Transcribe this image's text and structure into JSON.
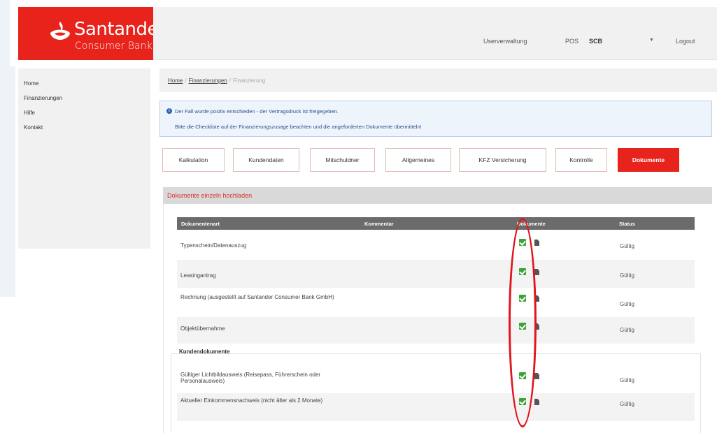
{
  "brand": {
    "name": "Santander",
    "subtitle": "Consumer Bank",
    "color": "#e8231b"
  },
  "header": {
    "user_admin": "Userverwaltung",
    "pos_label": "POS",
    "pos_value": "SCB",
    "logout": "Logout"
  },
  "sidebar": {
    "items": [
      {
        "label": "Home"
      },
      {
        "label": "Finanzierungen"
      },
      {
        "label": "Hilfe"
      },
      {
        "label": "Kontakt"
      }
    ]
  },
  "breadcrumb": {
    "home": "Home",
    "finance_list": "Finanzierungen",
    "current": "Finanzierung"
  },
  "info": {
    "line1": "Der Fall wurde positiv entschieden - der Vertragsdruck ist freigegeben.",
    "line2": "Bitte die Checkliste auf der Finanzierungszusage beachten und die angeforderten Dokumente übermitteln!"
  },
  "tabs": [
    {
      "label": "Kalkulation"
    },
    {
      "label": "Kundendaten"
    },
    {
      "label": "Mitschuldner"
    },
    {
      "label": "Allgemeines"
    },
    {
      "label": "KFZ Versicherung"
    },
    {
      "label": "Kontrolle"
    },
    {
      "label": "Dokumente",
      "active": true
    }
  ],
  "section_title": "Dokumente einzeln hochladen",
  "table": {
    "headers": {
      "type": "Dokumentenart",
      "comment": "Kommentar",
      "documents": "Dokumente",
      "status": "Status"
    },
    "rows": [
      {
        "type": "Typenschein/Datenauszug",
        "status": "Gültig"
      },
      {
        "type": "Leasingantrag",
        "status": "Gültig"
      },
      {
        "type": "Rechnung (ausgestellt auf Santander Consumer Bank GmbH)",
        "status": "Gültig"
      },
      {
        "type": "Objektübernahme",
        "status": "Gültig"
      }
    ],
    "customer_section": "Kundendokumente",
    "customer_rows": [
      {
        "type": "Gültiger Lichtbildausweis (Reisepass, Führerschein oder Personalausweis)",
        "status": "Gültig"
      },
      {
        "type": "Aktueller Einkommensnachweis (nicht älter als 2 Monate)",
        "status": "Gültig"
      }
    ]
  },
  "icons": {
    "uploaded": "checkbox-checked-icon",
    "file": "file-icon",
    "info": "info-icon"
  },
  "colors": {
    "accent": "#e8231b",
    "check": "#3aa435",
    "info_text": "#2b4f8a",
    "annotation": "#e0141c"
  }
}
